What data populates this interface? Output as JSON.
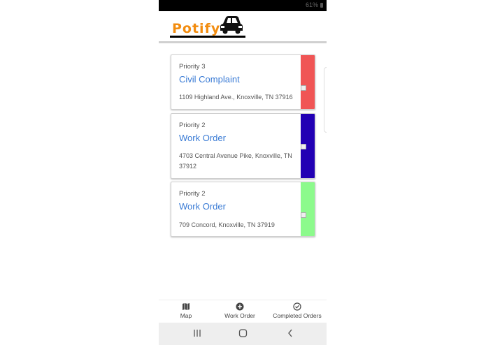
{
  "status_bar": {
    "battery": "61%"
  },
  "app": {
    "logo_text": "Potify"
  },
  "orders": [
    {
      "priority": "Priority 3",
      "title": "Civil Complaint",
      "address": "1109 Highland Ave., Knoxville, TN 37916",
      "color": "#f05555",
      "checked": false
    },
    {
      "priority": "Priority 2",
      "title": "Work Order",
      "address": "4703 Central Avenue Pike, Knoxville, TN 37912",
      "color": "#2200b4",
      "checked": false
    },
    {
      "priority": "Priority 2",
      "title": "Work Order",
      "address": "709 Concord, Knoxville, TN 37919",
      "color": "#8cfa8c",
      "checked": false
    }
  ],
  "bottom_nav": {
    "map_label": "Map",
    "work_order_label": "Work Order",
    "completed_label": "Completed Orders"
  },
  "icons": {
    "map": "map-icon",
    "add": "add-circle-icon",
    "check": "check-circle-icon",
    "recents": "recents-icon",
    "home": "home-icon",
    "back": "back-icon"
  }
}
